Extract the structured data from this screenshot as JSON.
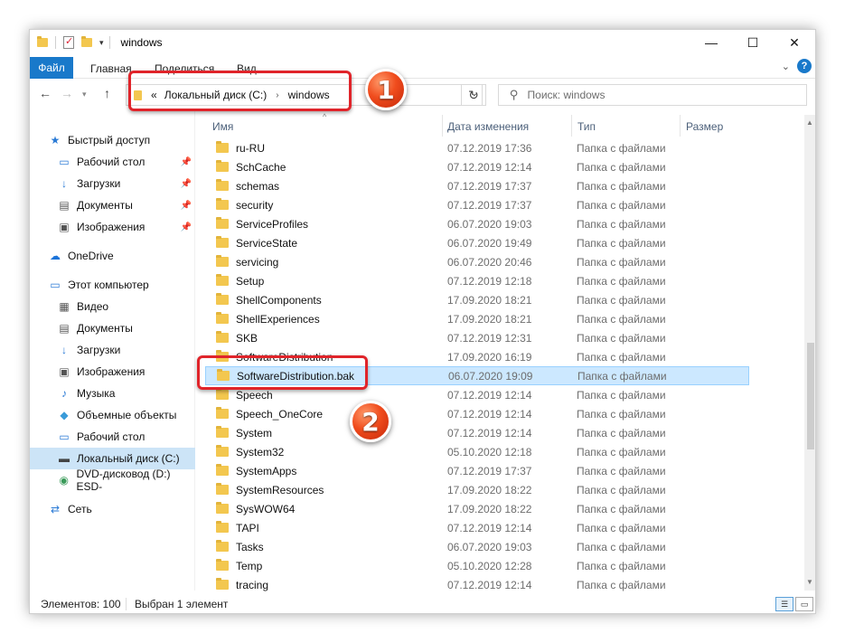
{
  "window": {
    "title": "windows",
    "controls": {
      "minimize": "—",
      "maximize": "☐",
      "close": "✕"
    }
  },
  "ribbon": {
    "tabs": [
      "Файл",
      "Главная",
      "Поделиться",
      "Вид"
    ],
    "help": "?"
  },
  "nav": {
    "address": {
      "overflow": "«",
      "crumbs": [
        "Локальный диск (C:)",
        "windows"
      ]
    },
    "search_placeholder": "Поиск: windows"
  },
  "sidebar": {
    "items": [
      {
        "label": "Быстрый доступ",
        "icon": "star-icon",
        "pinned": false
      },
      {
        "label": "Рабочий стол",
        "icon": "desktop-icon",
        "pinned": true
      },
      {
        "label": "Загрузки",
        "icon": "download-icon",
        "pinned": true
      },
      {
        "label": "Документы",
        "icon": "documents-icon",
        "pinned": true
      },
      {
        "label": "Изображения",
        "icon": "pictures-icon",
        "pinned": true
      },
      {
        "label": "OneDrive",
        "icon": "cloud-icon",
        "pinned": false
      },
      {
        "label": "Этот компьютер",
        "icon": "computer-icon",
        "pinned": false
      },
      {
        "label": "Видео",
        "icon": "video-icon",
        "pinned": false
      },
      {
        "label": "Документы",
        "icon": "documents-icon",
        "pinned": false
      },
      {
        "label": "Загрузки",
        "icon": "download-icon",
        "pinned": false
      },
      {
        "label": "Изображения",
        "icon": "pictures-icon",
        "pinned": false
      },
      {
        "label": "Музыка",
        "icon": "music-icon",
        "pinned": false
      },
      {
        "label": "Объемные объекты",
        "icon": "3d-objects-icon",
        "pinned": false
      },
      {
        "label": "Рабочий стол",
        "icon": "desktop-icon",
        "pinned": false
      },
      {
        "label": "Локальный диск (C:)",
        "icon": "drive-icon",
        "pinned": false,
        "selected": true
      },
      {
        "label": "DVD-дисковод (D:) ESD-",
        "icon": "dvd-icon",
        "pinned": false
      },
      {
        "label": "Сеть",
        "icon": "network-icon",
        "pinned": false
      }
    ]
  },
  "columns": {
    "name": "Имя",
    "date": "Дата изменения",
    "type": "Тип",
    "size": "Размер"
  },
  "files": [
    {
      "name": "ru-RU",
      "date": "07.12.2019 17:36",
      "type": "Папка с файлами"
    },
    {
      "name": "SchCache",
      "date": "07.12.2019 12:14",
      "type": "Папка с файлами"
    },
    {
      "name": "schemas",
      "date": "07.12.2019 17:37",
      "type": "Папка с файлами"
    },
    {
      "name": "security",
      "date": "07.12.2019 17:37",
      "type": "Папка с файлами"
    },
    {
      "name": "ServiceProfiles",
      "date": "06.07.2020 19:03",
      "type": "Папка с файлами"
    },
    {
      "name": "ServiceState",
      "date": "06.07.2020 19:49",
      "type": "Папка с файлами"
    },
    {
      "name": "servicing",
      "date": "06.07.2020 20:46",
      "type": "Папка с файлами"
    },
    {
      "name": "Setup",
      "date": "07.12.2019 12:18",
      "type": "Папка с файлами"
    },
    {
      "name": "ShellComponents",
      "date": "17.09.2020 18:21",
      "type": "Папка с файлами"
    },
    {
      "name": "ShellExperiences",
      "date": "17.09.2020 18:21",
      "type": "Папка с файлами"
    },
    {
      "name": "SKB",
      "date": "07.12.2019 12:31",
      "type": "Папка с файлами"
    },
    {
      "name": "SoftwareDistribution",
      "date": "17.09.2020 16:19",
      "type": "Папка с файлами"
    },
    {
      "name": "SoftwareDistribution.bak",
      "date": "06.07.2020 19:09",
      "type": "Папка с файлами",
      "selected": true
    },
    {
      "name": "Speech",
      "date": "07.12.2019 12:14",
      "type": "Папка с файлами"
    },
    {
      "name": "Speech_OneCore",
      "date": "07.12.2019 12:14",
      "type": "Папка с файлами"
    },
    {
      "name": "System",
      "date": "07.12.2019 12:14",
      "type": "Папка с файлами"
    },
    {
      "name": "System32",
      "date": "05.10.2020 12:18",
      "type": "Папка с файлами"
    },
    {
      "name": "SystemApps",
      "date": "07.12.2019 17:37",
      "type": "Папка с файлами"
    },
    {
      "name": "SystemResources",
      "date": "17.09.2020 18:22",
      "type": "Папка с файлами"
    },
    {
      "name": "SysWOW64",
      "date": "17.09.2020 18:22",
      "type": "Папка с файлами"
    },
    {
      "name": "TAPI",
      "date": "07.12.2019 12:14",
      "type": "Папка с файлами"
    },
    {
      "name": "Tasks",
      "date": "06.07.2020 19:03",
      "type": "Папка с файлами"
    },
    {
      "name": "Temp",
      "date": "05.10.2020 12:28",
      "type": "Папка с файлами"
    },
    {
      "name": "tracing",
      "date": "07.12.2019 12:14",
      "type": "Папка с файлами"
    }
  ],
  "status": {
    "count": "Элементов: 100",
    "selection": "Выбран 1 элемент"
  },
  "annotations": {
    "badge1": "1",
    "badge2": "2"
  },
  "colors": {
    "accent": "#1979ca",
    "selection": "#cce8ff",
    "highlight": "#e0242a"
  }
}
